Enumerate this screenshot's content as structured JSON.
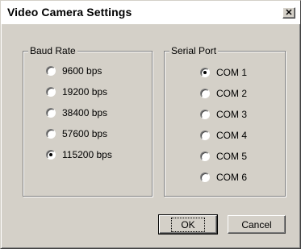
{
  "window": {
    "title": "Video Camera Settings",
    "close_glyph": "✕"
  },
  "baud_rate": {
    "label": "Baud Rate",
    "options": [
      {
        "label": "9600 bps",
        "checked": false
      },
      {
        "label": "19200 bps",
        "checked": false
      },
      {
        "label": "38400 bps",
        "checked": false
      },
      {
        "label": "57600 bps",
        "checked": false
      },
      {
        "label": "115200 bps",
        "checked": true
      }
    ]
  },
  "serial_port": {
    "label": "Serial Port",
    "options": [
      {
        "label": "COM 1",
        "checked": true
      },
      {
        "label": "COM 2",
        "checked": false
      },
      {
        "label": "COM 3",
        "checked": false
      },
      {
        "label": "COM 4",
        "checked": false
      },
      {
        "label": "COM 5",
        "checked": false
      },
      {
        "label": "COM 6",
        "checked": false
      }
    ]
  },
  "buttons": {
    "ok_label": "OK",
    "cancel_label": "Cancel"
  }
}
